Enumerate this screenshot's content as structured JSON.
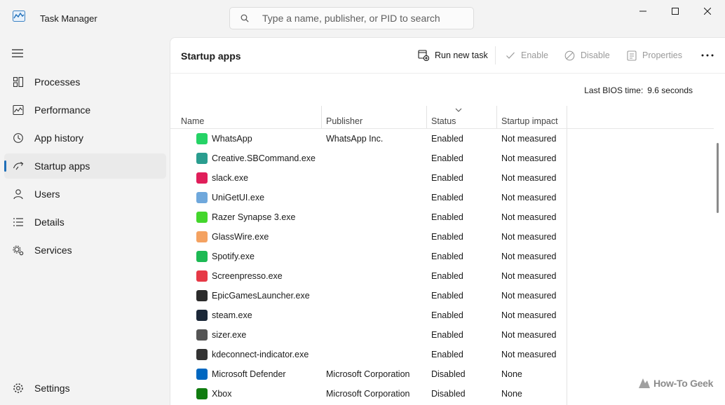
{
  "window": {
    "title": "Task Manager",
    "search_placeholder": "Type a name, publisher, or PID to search"
  },
  "sidebar": {
    "items": [
      {
        "label": "Processes",
        "icon": "processes-icon"
      },
      {
        "label": "Performance",
        "icon": "performance-icon"
      },
      {
        "label": "App history",
        "icon": "app-history-icon"
      },
      {
        "label": "Startup apps",
        "icon": "startup-apps-icon",
        "active": true
      },
      {
        "label": "Users",
        "icon": "users-icon"
      },
      {
        "label": "Details",
        "icon": "details-icon"
      },
      {
        "label": "Services",
        "icon": "services-icon"
      }
    ],
    "settings_label": "Settings"
  },
  "main": {
    "title": "Startup apps",
    "toolbar": {
      "run_new_task": "Run new task",
      "enable": "Enable",
      "disable": "Disable",
      "properties": "Properties"
    },
    "bios_label": "Last BIOS time:",
    "bios_value": "9.6 seconds",
    "columns": [
      "Name",
      "Publisher",
      "Status",
      "Startup impact"
    ],
    "rows": [
      {
        "name": "WhatsApp",
        "publisher": "WhatsApp Inc.",
        "status": "Enabled",
        "impact": "Not measured",
        "icon_color": "#25d366"
      },
      {
        "name": "Creative.SBCommand.exe",
        "publisher": "",
        "status": "Enabled",
        "impact": "Not measured",
        "icon_color": "#2a9d8f"
      },
      {
        "name": "slack.exe",
        "publisher": "",
        "status": "Enabled",
        "impact": "Not measured",
        "icon_color": "#e01e5a"
      },
      {
        "name": "UniGetUI.exe",
        "publisher": "",
        "status": "Enabled",
        "impact": "Not measured",
        "icon_color": "#6fa8dc"
      },
      {
        "name": "Razer Synapse 3.exe",
        "publisher": "",
        "status": "Enabled",
        "impact": "Not measured",
        "icon_color": "#44d62c"
      },
      {
        "name": "GlassWire.exe",
        "publisher": "",
        "status": "Enabled",
        "impact": "Not measured",
        "icon_color": "#f4a261"
      },
      {
        "name": "Spotify.exe",
        "publisher": "",
        "status": "Enabled",
        "impact": "Not measured",
        "icon_color": "#1db954"
      },
      {
        "name": "Screenpresso.exe",
        "publisher": "",
        "status": "Enabled",
        "impact": "Not measured",
        "icon_color": "#e63946"
      },
      {
        "name": "EpicGamesLauncher.exe",
        "publisher": "",
        "status": "Enabled",
        "impact": "Not measured",
        "icon_color": "#2b2b2b"
      },
      {
        "name": "steam.exe",
        "publisher": "",
        "status": "Enabled",
        "impact": "Not measured",
        "icon_color": "#1b2838"
      },
      {
        "name": "sizer.exe",
        "publisher": "",
        "status": "Enabled",
        "impact": "Not measured",
        "icon_color": "#555555"
      },
      {
        "name": "kdeconnect-indicator.exe",
        "publisher": "",
        "status": "Enabled",
        "impact": "Not measured",
        "icon_color": "#333333"
      },
      {
        "name": "Microsoft Defender",
        "publisher": "Microsoft Corporation",
        "status": "Disabled",
        "impact": "None",
        "icon_color": "#0067c0"
      },
      {
        "name": "Xbox",
        "publisher": "Microsoft Corporation",
        "status": "Disabled",
        "impact": "None",
        "icon_color": "#107c10"
      }
    ]
  },
  "watermark": "How-To Geek",
  "colors": {
    "accent": "#1f6fb8",
    "sidebar_bg": "#f3f3f3",
    "panel_bg": "#ffffff",
    "disabled_text": "#9a9a9a"
  }
}
